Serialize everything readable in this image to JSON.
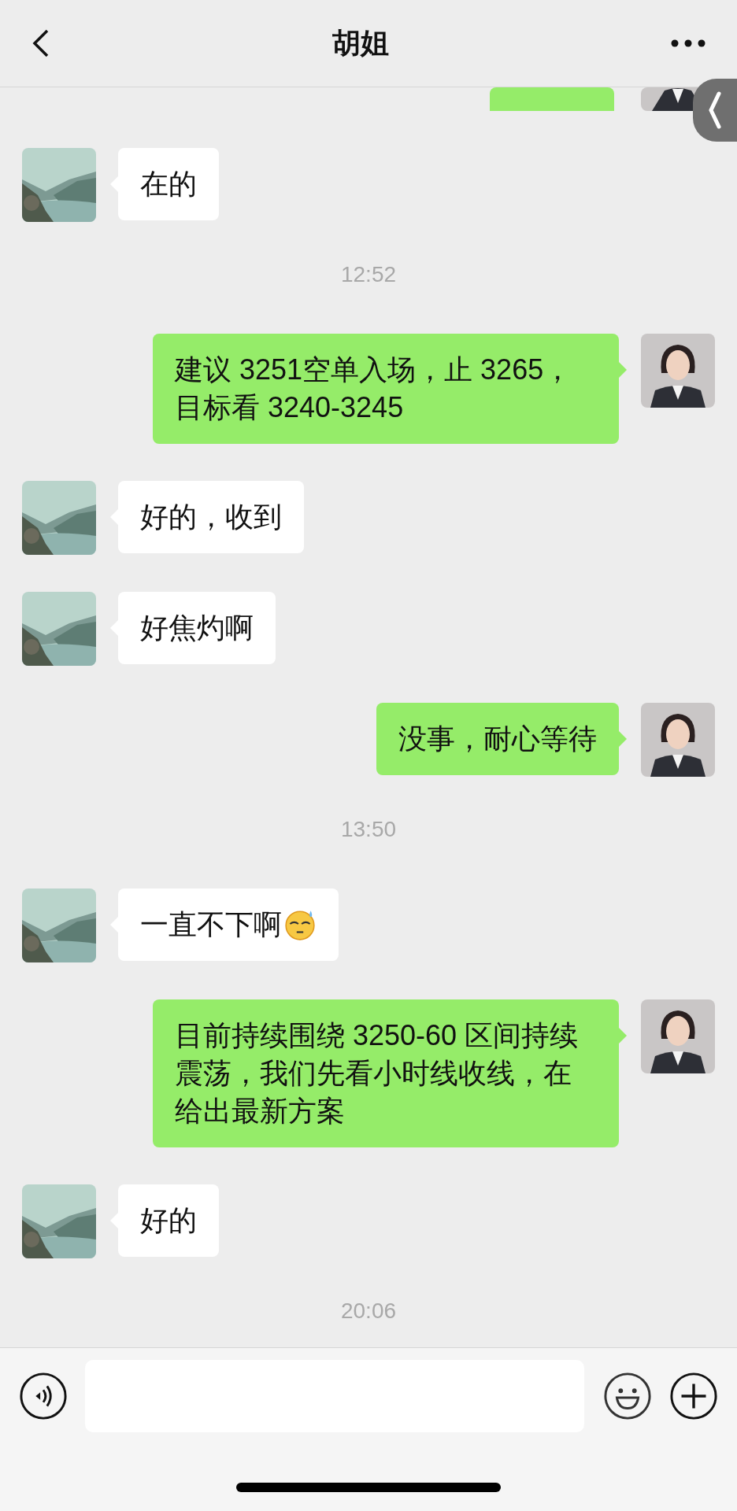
{
  "header": {
    "title": "胡姐"
  },
  "messages": [
    {
      "kind": "clipped_outgoing"
    },
    {
      "kind": "incoming",
      "text": "在的",
      "emoji": false
    },
    {
      "kind": "time",
      "text": "12:52"
    },
    {
      "kind": "outgoing",
      "text": "建议 3251空单入场，止 3265，目标看 3240-3245",
      "emoji": false
    },
    {
      "kind": "incoming",
      "text": "好的，收到",
      "emoji": false
    },
    {
      "kind": "incoming",
      "text": "好焦灼啊",
      "emoji": false
    },
    {
      "kind": "outgoing",
      "text": "没事，耐心等待",
      "emoji": false
    },
    {
      "kind": "time",
      "text": "13:50"
    },
    {
      "kind": "incoming",
      "text": "一直不下啊",
      "emoji": true
    },
    {
      "kind": "outgoing",
      "text": "目前持续围绕 3250-60 区间持续震荡，我们先看小时线收线，在给出最新方案",
      "emoji": false
    },
    {
      "kind": "incoming",
      "text": "好的",
      "emoji": false
    },
    {
      "kind": "time",
      "text": "20:06"
    }
  ]
}
